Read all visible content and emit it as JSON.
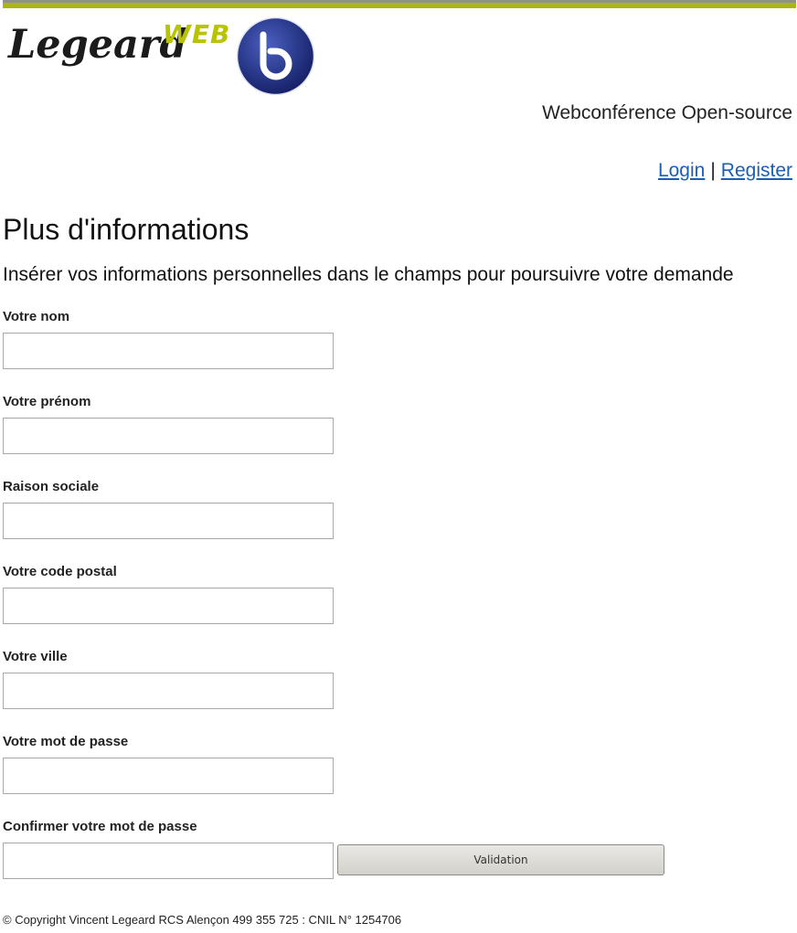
{
  "header": {
    "brand_name": "Legeard",
    "brand_suffix": "WEB",
    "brand_color": "#b8c400",
    "logo_icon": "bigbluebutton-logo-icon",
    "tagline": "Webconférence Open-source"
  },
  "auth": {
    "login_label": "Login",
    "separator": "|",
    "register_label": "Register"
  },
  "page": {
    "title": "Plus d'informations",
    "subtitle": "Insérer vos informations personnelles dans le champs pour poursuivre votre demande"
  },
  "form": {
    "fields": [
      {
        "label": "Votre nom",
        "value": "",
        "placeholder": ""
      },
      {
        "label": "Votre prénom",
        "value": "",
        "placeholder": ""
      },
      {
        "label": "Raison sociale",
        "value": "",
        "placeholder": ""
      },
      {
        "label": "Votre code postal",
        "value": "",
        "placeholder": ""
      },
      {
        "label": "Votre ville",
        "value": "",
        "placeholder": ""
      },
      {
        "label": "Votre mot de passe",
        "value": "",
        "placeholder": ""
      },
      {
        "label": "Confirmer votre mot de passe",
        "value": "",
        "placeholder": ""
      }
    ],
    "submit_label": "Validation"
  },
  "footer": {
    "copyright": "© Copyright Vincent Legeard RCS Alençon 499 355 725 : CNIL N° 1254706"
  },
  "colors": {
    "accent_lime": "#aab516",
    "link_blue": "#1a5fb4",
    "logo_blue": "#2a3a8c"
  }
}
